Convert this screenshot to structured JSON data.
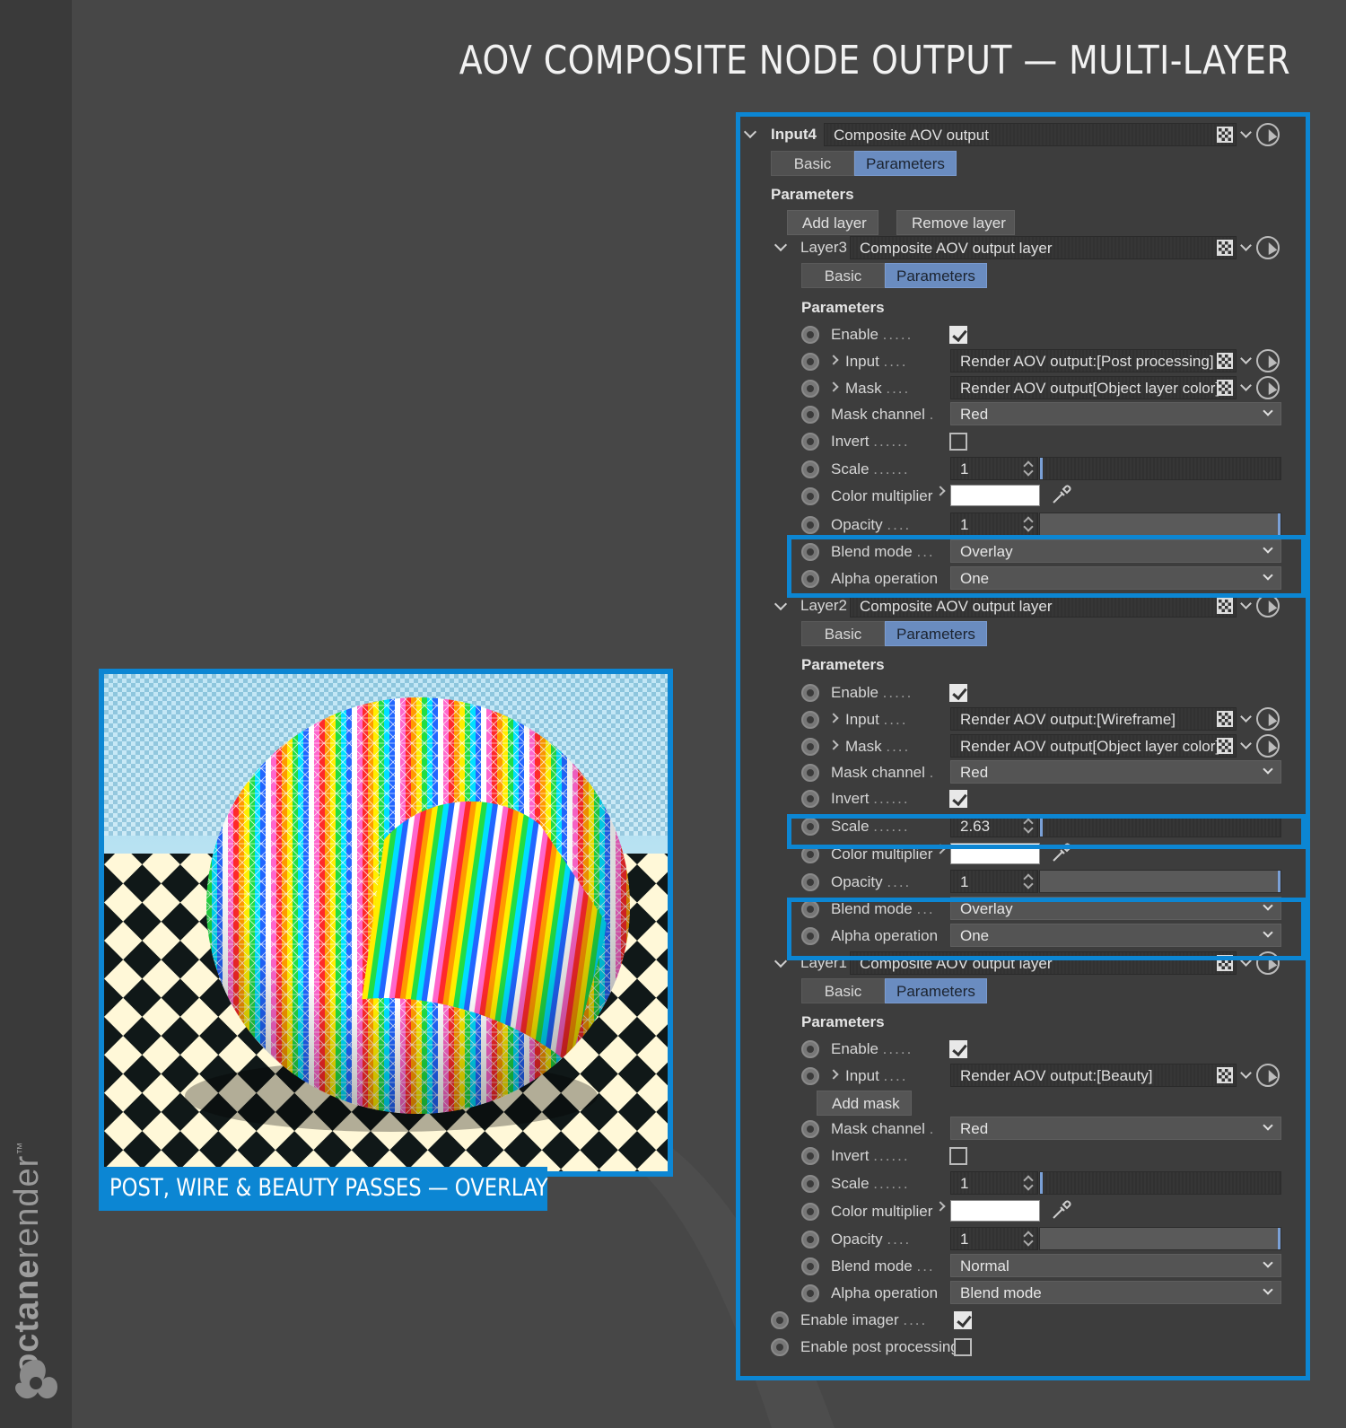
{
  "title": "AOV COMPOSITE NODE OUTPUT — MULTI-LAYER",
  "brand": {
    "prefix": "octane",
    "suffix": "render",
    "tm": "™"
  },
  "caption": "POST, WIRE & BEAUTY PASSES — OVERLAY",
  "colors": {
    "accent": "#0c86d3",
    "panel": "#3d3d3d",
    "background": "#474747",
    "tab_active": "#6a8cc0"
  },
  "panel": {
    "root_label": "Input4",
    "root_type": "Composite AOV output",
    "tabs": [
      "Basic",
      "Parameters"
    ],
    "section": "Parameters",
    "add_layer": "Add layer",
    "remove_layer": "Remove layer",
    "enable_imager": "Enable imager",
    "enable_imager_checked": true,
    "enable_post": "Enable post processing",
    "enable_post_checked": false,
    "labels": {
      "enable": "Enable",
      "input": "Input",
      "mask": "Mask",
      "mask_channel": "Mask channel",
      "invert": "Invert",
      "scale": "Scale",
      "color_multiplier": "Color multiplier",
      "opacity": "Opacity",
      "blend_mode": "Blend mode",
      "alpha_operation": "Alpha operation",
      "add_mask": "Add mask"
    },
    "layers": [
      {
        "label": "Layer3",
        "type": "Composite AOV output layer",
        "enable": true,
        "input": "Render AOV output:[Post processing]",
        "mask": "Render AOV output[Object layer color]",
        "mask_channel": "Red",
        "invert": false,
        "scale": "1",
        "color": "#ffffff",
        "opacity": "1",
        "blend_mode": "Overlay",
        "alpha_operation": "One"
      },
      {
        "label": "Layer2",
        "type": "Composite AOV output layer",
        "enable": true,
        "input": "Render AOV output:[Wireframe]",
        "mask": "Render AOV output[Object layer color]",
        "mask_channel": "Red",
        "invert": true,
        "scale": "2.63",
        "color": "#ffffff",
        "opacity": "1",
        "blend_mode": "Overlay",
        "alpha_operation": "One"
      },
      {
        "label": "Layer1",
        "type": "Composite AOV output layer",
        "enable": true,
        "input": "Render AOV output:[Beauty]",
        "mask_channel": "Red",
        "invert": false,
        "scale": "1",
        "color": "#ffffff",
        "opacity": "1",
        "blend_mode": "Normal",
        "alpha_operation": "Blend mode"
      }
    ]
  },
  "icons": [
    "octane-logo-icon",
    "collapse-chevron-icon",
    "node-grid-icon",
    "dropdown-arrow-icon",
    "node-picker-icon",
    "eyedropper-icon",
    "expand-chevron-icon",
    "spinner-arrows-icon"
  ]
}
